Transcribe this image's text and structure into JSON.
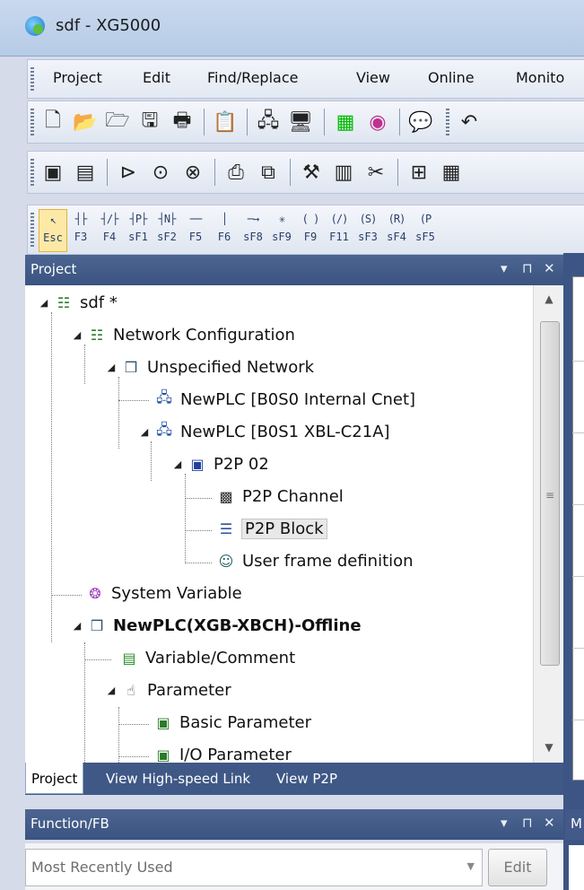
{
  "window": {
    "title": "sdf - XG5000"
  },
  "menu": [
    "Project",
    "Edit",
    "Find/Replace",
    "View",
    "Online",
    "Monito"
  ],
  "toolbar1": [
    {
      "name": "new-file-icon",
      "glyph": "🗋"
    },
    {
      "name": "open-folder-icon",
      "glyph": "📂"
    },
    {
      "name": "open-project-icon",
      "glyph": "🗁"
    },
    {
      "name": "save-icon",
      "glyph": "🖫"
    },
    {
      "name": "print-icon",
      "glyph": "🖶"
    },
    {
      "name": "clipboard-icon",
      "glyph": "📋"
    },
    {
      "name": "network-connect-icon",
      "glyph": "🖧"
    },
    {
      "name": "network-settings-icon",
      "glyph": "🖥"
    },
    {
      "name": "monitor-icon",
      "glyph": "▦"
    },
    {
      "name": "color-wheel-icon",
      "glyph": "◉"
    },
    {
      "name": "comment-icon",
      "glyph": "💬"
    },
    {
      "name": "undo-icon",
      "glyph": "↶"
    }
  ],
  "toolbar2": [
    {
      "name": "device-icon",
      "glyph": "▣"
    },
    {
      "name": "plc-icon",
      "glyph": "▤"
    },
    {
      "name": "run-icon",
      "glyph": "⊳"
    },
    {
      "name": "stop-icon",
      "glyph": "⊙"
    },
    {
      "name": "pause-icon",
      "glyph": "⊗"
    },
    {
      "name": "write-icon",
      "glyph": "⎙"
    },
    {
      "name": "read-icon",
      "glyph": "⧉"
    },
    {
      "name": "tool-icon",
      "glyph": "⚒"
    },
    {
      "name": "module-icon",
      "glyph": "▥"
    },
    {
      "name": "cut-icon",
      "glyph": "✂"
    },
    {
      "name": "compare-icon",
      "glyph": "⊞"
    },
    {
      "name": "grid-icon",
      "glyph": "▦"
    }
  ],
  "ladder": [
    {
      "sym": "↖",
      "key": "Esc"
    },
    {
      "sym": "┤├",
      "key": "F3"
    },
    {
      "sym": "┤/├",
      "key": "F4"
    },
    {
      "sym": "┤P├",
      "key": "sF1"
    },
    {
      "sym": "┤N├",
      "key": "sF2"
    },
    {
      "sym": "──",
      "key": "F5"
    },
    {
      "sym": "│",
      "key": "F6"
    },
    {
      "sym": "─→",
      "key": "sF8"
    },
    {
      "sym": "✳",
      "key": "sF9"
    },
    {
      "sym": "( )",
      "key": "F9"
    },
    {
      "sym": "(/)",
      "key": "F11"
    },
    {
      "sym": "(S)",
      "key": "sF3"
    },
    {
      "sym": "(R)",
      "key": "sF4"
    },
    {
      "sym": "(P",
      "key": "sF5"
    }
  ],
  "project_panel": {
    "title": "Project",
    "pin": "⊓",
    "close": "✕",
    "dropdown": "▾",
    "tree": [
      {
        "label": "sdf *",
        "icon": "net",
        "glyph": "☷",
        "bold": false
      },
      {
        "label": "Network Configuration",
        "icon": "net",
        "glyph": "☷",
        "bold": false
      },
      {
        "label": "Unspecified Network",
        "icon": "cube",
        "glyph": "❒",
        "bold": false
      },
      {
        "label": "NewPLC [B0S0 Internal Cnet]",
        "icon": "plc",
        "glyph": "🖧",
        "bold": false
      },
      {
        "label": "NewPLC [B0S1 XBL-C21A]",
        "icon": "plc",
        "glyph": "🖧",
        "bold": false
      },
      {
        "label": "P2P 02",
        "icon": "p2p",
        "glyph": "▣",
        "bold": false
      },
      {
        "label": "P2P Channel",
        "icon": "channel",
        "glyph": "▩",
        "bold": false
      },
      {
        "label": "P2P Block",
        "icon": "block",
        "glyph": "☰",
        "bold": false
      },
      {
        "label": "User frame definition",
        "icon": "user",
        "glyph": "☺",
        "bold": false
      },
      {
        "label": "System Variable",
        "icon": "sysvar",
        "glyph": "❂",
        "bold": false
      },
      {
        "label": "NewPLC(XGB-XBCH)-Offline",
        "icon": "cube",
        "glyph": "❒",
        "bold": true
      },
      {
        "label": "Variable/Comment",
        "icon": "var",
        "glyph": "▤",
        "bold": false
      },
      {
        "label": "Parameter",
        "icon": "param",
        "glyph": "☝",
        "bold": false
      },
      {
        "label": "Basic Parameter",
        "icon": "basic",
        "glyph": "▣",
        "bold": false
      },
      {
        "label": "I/O Parameter",
        "icon": "io",
        "glyph": "▣",
        "bold": false
      }
    ],
    "tabs": [
      "Project",
      "View High-speed Link",
      "View P2P"
    ]
  },
  "function_panel": {
    "title": "Function/FB",
    "combo_value": "Most Recently Used",
    "edit_label": "Edit"
  },
  "right_strip": {
    "lower_header": "M"
  }
}
